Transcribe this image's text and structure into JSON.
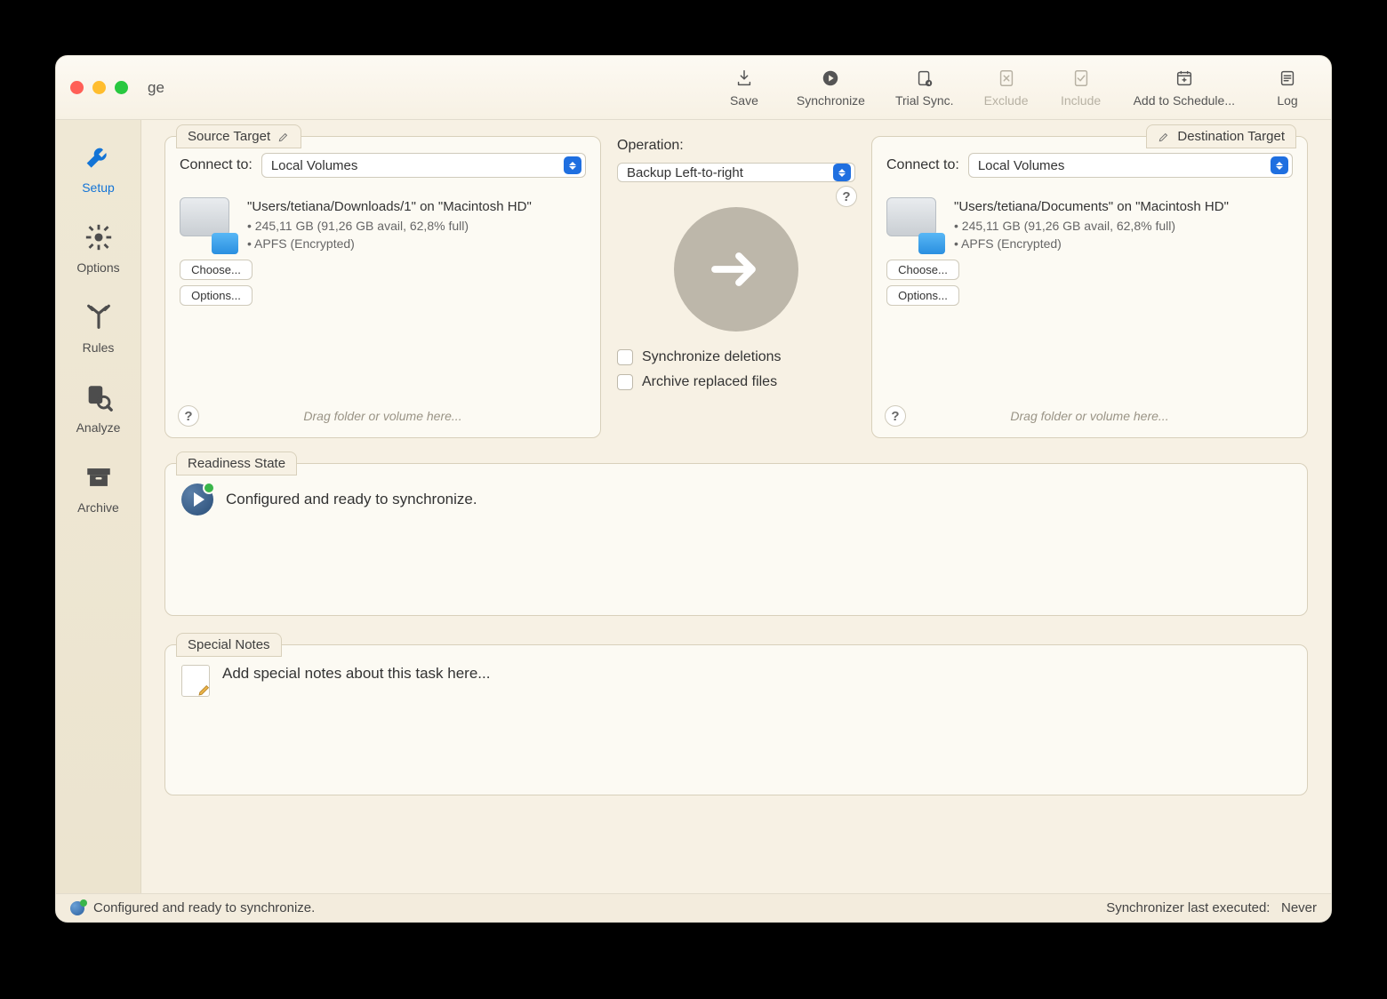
{
  "window": {
    "title": "ge"
  },
  "toolbar": {
    "save": "Save",
    "synchronize": "Synchronize",
    "trial_sync": "Trial Sync.",
    "exclude": "Exclude",
    "include": "Include",
    "add_to_schedule": "Add to Schedule...",
    "log": "Log"
  },
  "sidebar": {
    "setup": "Setup",
    "options": "Options",
    "rules": "Rules",
    "analyze": "Analyze",
    "archive": "Archive"
  },
  "source": {
    "tab": "Source Target",
    "connect_label": "Connect to:",
    "connect_value": "Local Volumes",
    "path": "\"Users/tetiana/Downloads/1\" on \"Macintosh HD\"",
    "stats": "• 245,11 GB (91,26 GB avail, 62,8% full)",
    "fs": "• APFS (Encrypted)",
    "choose": "Choose...",
    "options": "Options...",
    "hint": "Drag folder or volume here..."
  },
  "operation": {
    "label": "Operation:",
    "value": "Backup Left-to-right",
    "sync_deletions": "Synchronize deletions",
    "archive_replaced": "Archive replaced files"
  },
  "destination": {
    "tab": "Destination Target",
    "connect_label": "Connect to:",
    "connect_value": "Local Volumes",
    "path": "\"Users/tetiana/Documents\" on \"Macintosh HD\"",
    "stats": "• 245,11 GB (91,26 GB avail, 62,8% full)",
    "fs": "• APFS (Encrypted)",
    "choose": "Choose...",
    "options": "Options...",
    "hint": "Drag folder or volume here..."
  },
  "readiness": {
    "tab": "Readiness State",
    "text": "Configured and ready to synchronize."
  },
  "notes": {
    "tab": "Special Notes",
    "placeholder": "Add special notes about this task here..."
  },
  "status": {
    "left": "Configured and ready to synchronize.",
    "right_label": "Synchronizer last executed:",
    "right_value": "Never"
  }
}
